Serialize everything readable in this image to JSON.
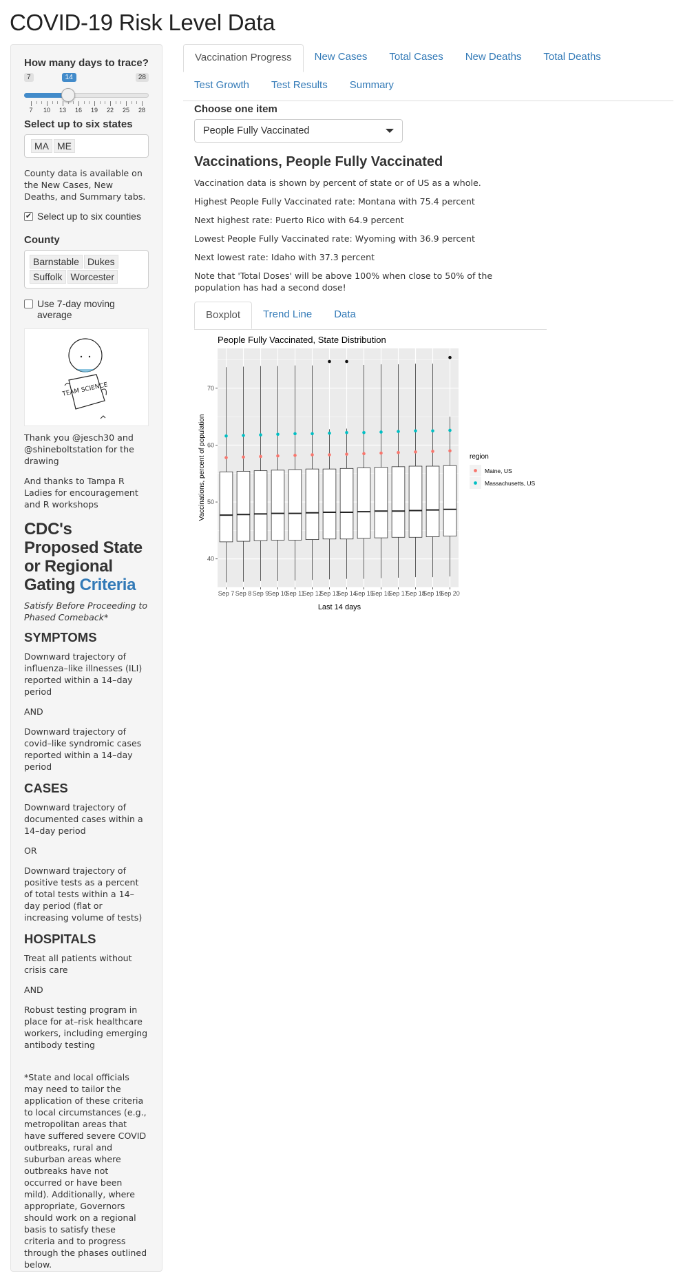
{
  "app": {
    "title": "COVID-19 Risk Level Data"
  },
  "sidebar": {
    "days_label": "How many days to trace?",
    "slider": {
      "min": 7,
      "max": 28,
      "value": 14,
      "min_label": "7",
      "max_label": "28",
      "value_label": "14",
      "tick_labels": [
        "7",
        "10",
        "13",
        "16",
        "19",
        "22",
        "25",
        "28"
      ]
    },
    "states_label": "Select up to six states",
    "states": [
      "MA",
      "ME"
    ],
    "county_note": "County data is available on the New Cases, New Deaths, and Summary tabs.",
    "six_counties_label": "Select up to six counties",
    "six_counties_checked": true,
    "county_label": "County",
    "counties": [
      "Barnstable",
      "Dukes",
      "Suffolk",
      "Worcester"
    ],
    "moving_avg_label": "Use 7-day moving average",
    "moving_avg_checked": false,
    "drawing_text": "TEAM SCIENCE",
    "thanks_1": "Thank you @jesch30 and @shineboltstation for the drawing",
    "thanks_2": "And thanks to Tampa R Ladies for encouragement and R workshops",
    "cdc_title_main": "CDC's Proposed State or Regional Gating",
    "cdc_title_link": "Criteria",
    "cdc_subtitle": "Satisfy Before Proceeding to Phased Comeback*",
    "symptoms_h": "SYMPTOMS",
    "symptoms_1": "Downward trajectory of influenza–like illnesses (ILI) reported within a 14–day period",
    "and_1": "AND",
    "symptoms_2": "Downward trajectory of covid–like syndromic cases reported within a 14–day period",
    "cases_h": "CASES",
    "cases_1": "Downward trajectory of documented cases within a 14–day period",
    "or_1": "OR",
    "cases_2": "Downward trajectory of positive tests as a percent of total tests within a 14–day period (flat or increasing volume of tests)",
    "hospitals_h": "HOSPITALS",
    "hospitals_1": "Treat all patients without crisis care",
    "and_2": "AND",
    "hospitals_2": "Robust testing program in place for at–risk healthcare workers, including emerging antibody testing",
    "footnote": "*State and local officials may need to tailor the application of these criteria to local circumstances (e.g., metropolitan areas that have suffered severe COVID outbreaks, rural and suburban areas where outbreaks have not occurred or have been mild). Additionally, where appropriate, Governors should work on a regional basis to satisfy these criteria and to progress through the phases outlined below."
  },
  "tabs": [
    {
      "label": "Vaccination Progress",
      "active": true
    },
    {
      "label": "New Cases",
      "active": false
    },
    {
      "label": "Total Cases",
      "active": false
    },
    {
      "label": "New Deaths",
      "active": false
    },
    {
      "label": "Total Deaths",
      "active": false
    },
    {
      "label": "Test Growth",
      "active": false
    },
    {
      "label": "Test Results",
      "active": false
    },
    {
      "label": "Summary",
      "active": false
    }
  ],
  "main": {
    "choose_label": "Choose one item",
    "selected_item": "People Fully Vaccinated",
    "section_title": "Vaccinations, People Fully Vaccinated",
    "p1": "Vaccination data is shown by percent of state or of US as a whole.",
    "p2": "Highest People Fully Vaccinated rate: Montana with 75.4 percent",
    "p3": "Next highest rate: Puerto Rico with 64.9 percent",
    "p4": "Lowest People Fully Vaccinated rate: Wyoming with 36.9 percent",
    "p5": "Next lowest rate: Idaho with 37.3 percent",
    "p6": "Note that 'Total Doses' will be above 100% when close to 50% of the population has had a second dose!",
    "subtabs": [
      {
        "label": "Boxplot",
        "active": true
      },
      {
        "label": "Trend Line",
        "active": false
      },
      {
        "label": "Data",
        "active": false
      }
    ]
  },
  "colors": {
    "accent": "#337ab7",
    "maine": "#f8766d",
    "massachusetts": "#00bfc4",
    "panel_bg": "#ebebeb"
  },
  "chart_data": {
    "type": "boxplot",
    "title": "People Fully Vaccinated, State Distribution",
    "xlabel": "Last 14 days",
    "ylabel": "Vaccinations, percent of population",
    "ylim": [
      35,
      77
    ],
    "yticks": [
      40,
      50,
      60,
      70
    ],
    "grid": true,
    "legend_title": "region",
    "legend_position": "right",
    "categories": [
      "Sep 7",
      "Sep 8",
      "Sep 9",
      "Sep 10",
      "Sep 11",
      "Sep 12",
      "Sep 13",
      "Sep 14",
      "Sep 15",
      "Sep 16",
      "Sep 17",
      "Sep 18",
      "Sep 19",
      "Sep 20"
    ],
    "boxes": [
      {
        "min": 35.9,
        "q1": 43.0,
        "median": 47.7,
        "q3": 55.3,
        "max": 73.7
      },
      {
        "min": 36.0,
        "q1": 43.1,
        "median": 47.8,
        "q3": 55.4,
        "max": 73.8
      },
      {
        "min": 36.1,
        "q1": 43.2,
        "median": 47.9,
        "q3": 55.5,
        "max": 73.9
      },
      {
        "min": 36.1,
        "q1": 43.3,
        "median": 48.0,
        "q3": 55.6,
        "max": 73.9
      },
      {
        "min": 36.2,
        "q1": 43.3,
        "median": 48.0,
        "q3": 55.7,
        "max": 74.0
      },
      {
        "min": 36.3,
        "q1": 43.4,
        "median": 48.1,
        "q3": 55.8,
        "max": 74.0
      },
      {
        "min": 36.4,
        "q1": 43.5,
        "median": 48.2,
        "q3": 55.8,
        "max": 62.8,
        "outliers": [
          74.7
        ]
      },
      {
        "min": 36.5,
        "q1": 43.5,
        "median": 48.2,
        "q3": 55.9,
        "max": 62.9,
        "outliers": [
          74.7
        ]
      },
      {
        "min": 36.5,
        "q1": 43.6,
        "median": 48.3,
        "q3": 56.0,
        "max": 74.1
      },
      {
        "min": 36.6,
        "q1": 43.7,
        "median": 48.4,
        "q3": 56.1,
        "max": 74.2
      },
      {
        "min": 36.7,
        "q1": 43.8,
        "median": 48.4,
        "q3": 56.2,
        "max": 74.2
      },
      {
        "min": 36.8,
        "q1": 43.8,
        "median": 48.5,
        "q3": 56.3,
        "max": 74.3
      },
      {
        "min": 36.8,
        "q1": 43.9,
        "median": 48.6,
        "q3": 56.3,
        "max": 74.3
      },
      {
        "min": 36.9,
        "q1": 44.0,
        "median": 48.7,
        "q3": 56.4,
        "max": 65.0,
        "outliers": [
          75.4
        ]
      }
    ],
    "series": [
      {
        "name": "Maine, US",
        "color": "#f8766d",
        "values": [
          57.8,
          57.9,
          58.0,
          58.1,
          58.2,
          58.3,
          58.3,
          58.4,
          58.5,
          58.6,
          58.7,
          58.8,
          58.9,
          59.0
        ]
      },
      {
        "name": "Massachusetts, US",
        "color": "#00bfc4",
        "values": [
          61.6,
          61.7,
          61.8,
          61.9,
          62.0,
          62.0,
          62.1,
          62.2,
          62.2,
          62.3,
          62.4,
          62.5,
          62.5,
          62.6
        ]
      }
    ]
  }
}
